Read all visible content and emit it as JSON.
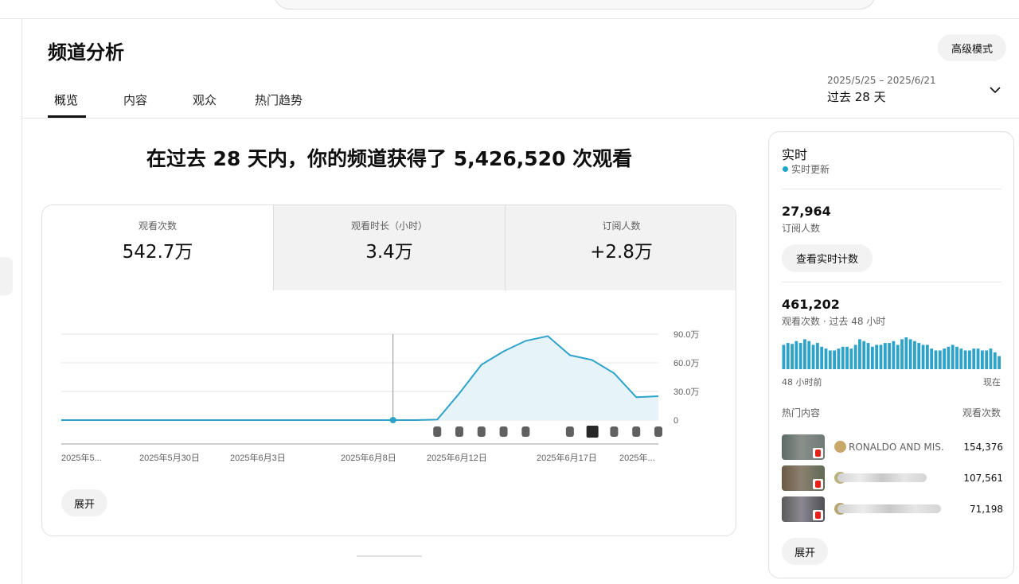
{
  "header": {
    "title": "频道分析",
    "advanced_mode": "高级模式",
    "tabs": [
      "概览",
      "内容",
      "观众",
      "热门趋势"
    ],
    "date_range": "2025/5/25 – 2025/6/21",
    "date_period": "过去 28 天"
  },
  "headline": "在过去 28 天内，你的频道获得了 5,426,520 次观看",
  "metrics": [
    {
      "label": "观看次数",
      "value": "542.7万"
    },
    {
      "label": "观看时长（小时）",
      "value": "3.4万"
    },
    {
      "label": "订阅人数",
      "value": "+2.8万"
    }
  ],
  "expand_label": "展开",
  "colors": {
    "line": "#2da3c9",
    "fill": "#e6f4fa",
    "shorts": "#606060"
  },
  "chart_data": {
    "type": "area",
    "x": [
      "2025/5/25",
      "2025/5/26",
      "2025/5/27",
      "2025/5/28",
      "2025/5/29",
      "2025/5/30",
      "2025/5/31",
      "2025/6/1",
      "2025/6/2",
      "2025/6/3",
      "2025/6/4",
      "2025/6/5",
      "2025/6/6",
      "2025/6/7",
      "2025/6/8",
      "2025/6/9",
      "2025/6/10",
      "2025/6/11",
      "2025/6/12",
      "2025/6/13",
      "2025/6/14",
      "2025/6/15",
      "2025/6/16",
      "2025/6/17",
      "2025/6/18",
      "2025/6/19",
      "2025/6/20",
      "2025/6/21"
    ],
    "series": [
      {
        "values": [
          0,
          0,
          0,
          0,
          0,
          0,
          0,
          0,
          0,
          0,
          0,
          0,
          0,
          0,
          0,
          0,
          0,
          5000,
          280000,
          580000,
          720000,
          830000,
          880000,
          680000,
          630000,
          490000,
          240000,
          250000
        ]
      }
    ],
    "ylim": [
      0,
      900000
    ],
    "ytick_labels": [
      "0",
      "30.0万",
      "60.0万",
      "90.0万"
    ],
    "xtick_labels": [
      "2025年5...",
      "2025年5月30日",
      "2025年6月3日",
      "2025年6月8日",
      "2025年6月12日",
      "2025年6月17日",
      "2025年..."
    ],
    "grid": true
  },
  "realtime": {
    "title": "实时",
    "live_label": "实时更新",
    "subscribers": "27,964",
    "subscribers_label": "订阅人数",
    "view_count_button": "查看实时计数",
    "views": "461,202",
    "views_label": "观看次数 · 过去 48 小时",
    "bars": [
      26,
      28,
      27,
      30,
      28,
      32,
      30,
      26,
      28,
      24,
      22,
      20,
      20,
      22,
      24,
      24,
      22,
      26,
      32,
      30,
      28,
      24,
      26,
      26,
      28,
      28,
      30,
      26,
      32,
      34,
      32,
      30,
      28,
      26,
      26,
      22,
      20,
      20,
      22,
      24,
      26,
      24,
      22,
      20,
      20,
      22,
      22,
      20,
      20,
      22,
      18,
      14
    ],
    "axis_left": "48 小时前",
    "axis_right": "现在",
    "top_label": "热门内容",
    "views_col_label": "观看次数",
    "top_items": [
      {
        "title": "RONALDO AND MIS...",
        "views": "154,376"
      },
      {
        "title": "",
        "views": "107,561"
      },
      {
        "title": "",
        "views": "71,198"
      }
    ],
    "expand_label": "展开"
  }
}
